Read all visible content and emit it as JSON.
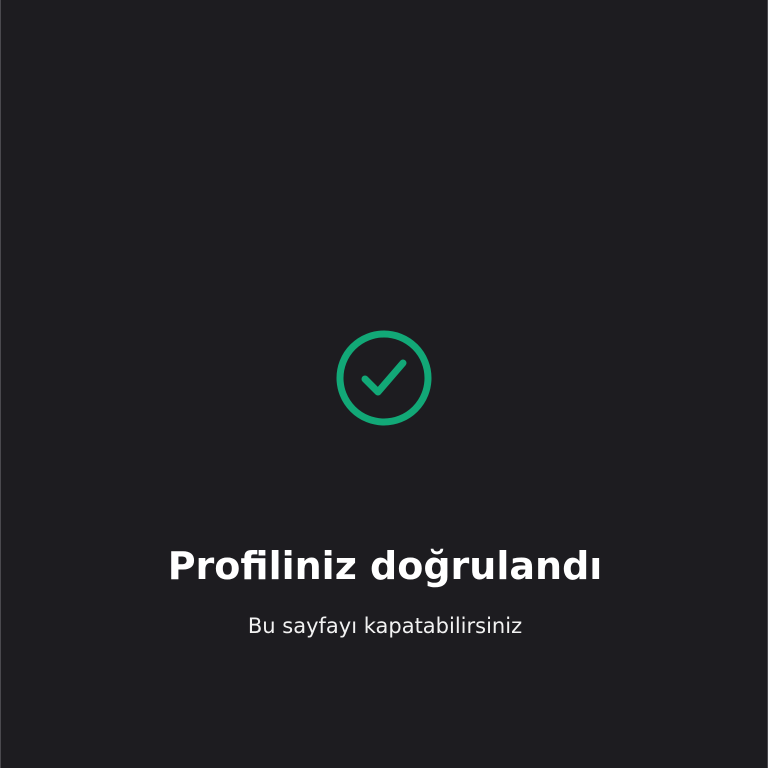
{
  "status": {
    "icon": "check-circle-icon",
    "accent_color": "#12a877",
    "title": "Profiliniz doğrulandı",
    "subtitle": "Bu sayfayı kapatabilirsiniz"
  },
  "colors": {
    "background": "#1d1c20",
    "text": "#ffffff"
  }
}
